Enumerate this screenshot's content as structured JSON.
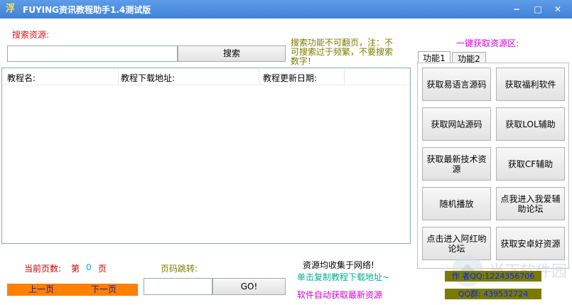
{
  "window": {
    "title": "FUYING资讯教程助手1.4测试版",
    "min_glyph": "−",
    "max_glyph": "□",
    "close_glyph": "✕"
  },
  "search": {
    "label": "搜索资源:",
    "input_value": "",
    "button_label": "搜索",
    "notice": "搜索功能不可翻页，注：不可搜索过于频繁，不要搜索数字!"
  },
  "list": {
    "columns": [
      "教程名:",
      "教程下载地址:",
      "教程更新日期:"
    ],
    "rows": []
  },
  "side": {
    "title": "一键获取资源区:",
    "tabs": [
      "功能1",
      "功能2"
    ],
    "active_tab": 0,
    "buttons": [
      "获取易语言源码",
      "获取福利软件",
      "获取网站源码",
      "获取LOL辅助",
      "获取最新技术资源",
      "获取CF辅助",
      "随机播放",
      "点我进入我爱辅助论坛",
      "点击进入阿红哟论坛",
      "获取安卓好资源"
    ]
  },
  "pager": {
    "current_label": "当前页数:",
    "page_prefix": "第",
    "page_number": "0",
    "page_suffix": "页",
    "jump_label": "页码跳转:",
    "prev_label": "上一页",
    "next_label": "下一页",
    "go_label": "GO!"
  },
  "notes": {
    "line1": "资源均收集于网络!",
    "line2": "单击复制教程下载地址~",
    "line3": "软件自动获取最新资源"
  },
  "contact": {
    "qq": "作 者QQ:1224356706",
    "group": "QQ群: 439532724"
  },
  "watermark": {
    "text": "当下软件园"
  },
  "colors": {
    "title_bar": "#4a8de0",
    "accent_red": "#e01414",
    "accent_orange": "#ff7f00",
    "accent_magenta": "#d600d6",
    "accent_cyan": "#00b090",
    "olive": "#7b7b00"
  }
}
